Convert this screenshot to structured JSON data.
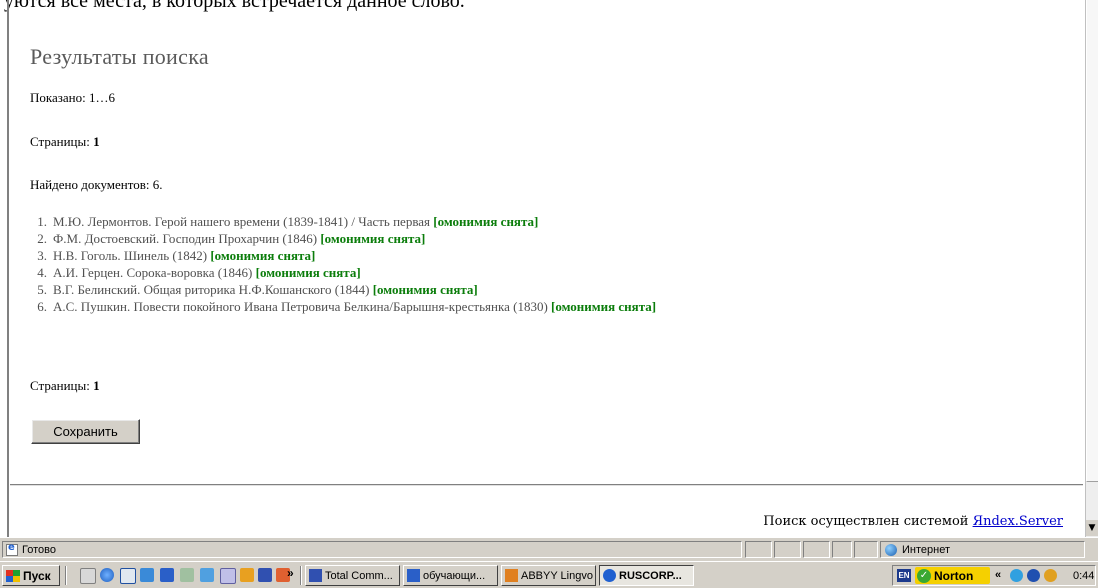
{
  "cropped_top_text": "уются все места, в которых встречается данное слово.",
  "page": {
    "title": "Результаты поиска",
    "shown_label": "Показано:",
    "shown_value": "1…6",
    "pages_label": "Страницы:",
    "pages_value": "1",
    "found_label": "Найдено документов:",
    "found_value": "6."
  },
  "results": [
    {
      "num": "1.",
      "text": "М.Ю. Лермонтов. Герой нашего времени (1839-1841) / Часть первая",
      "tag": "[омонимия снята]"
    },
    {
      "num": "2.",
      "text": "Ф.М. Достоевский. Господин Прохарчин (1846)",
      "tag": "[омонимия снята]"
    },
    {
      "num": "3.",
      "text": "Н.В. Гоголь. Шинель (1842)",
      "tag": "[омонимия снята]"
    },
    {
      "num": "4.",
      "text": "А.И. Герцен. Сорока-воровка (1846)",
      "tag": "[омонимия снята]"
    },
    {
      "num": "5.",
      "text": "В.Г. Белинский. Общая риторика Н.Ф.Кошанского (1844)",
      "tag": "[омонимия снята]"
    },
    {
      "num": "6.",
      "text": "А.С. Пушкин. Повести покойного Ивана Петровича Белкина/Барышня-крестьянка (1830)",
      "tag": "[омонимия снята]"
    }
  ],
  "bottom": {
    "pages_label": "Страницы:",
    "pages_value": "1",
    "save_label": "Сохранить"
  },
  "footer": {
    "text": "Поиск осуществлен системой",
    "link": "Яndex.Server"
  },
  "statusbar": {
    "status": "Готово",
    "zone": "Интернет"
  },
  "taskbar": {
    "start": "Пуск",
    "more": "»",
    "tasks": [
      {
        "label": "Total Comm...",
        "active": false,
        "icon_color": "#3050b0"
      },
      {
        "label": "обучающи...",
        "active": false,
        "icon_color": "#2a5fc8"
      },
      {
        "label": "ABBYY Lingvo",
        "active": false,
        "icon_color": "#e08020"
      },
      {
        "label": "RUSCORP...",
        "active": true,
        "icon_color": "#2060d0"
      }
    ],
    "lang": "EN",
    "norton": "Norton",
    "tray_more": "«",
    "clock": "0:44"
  }
}
